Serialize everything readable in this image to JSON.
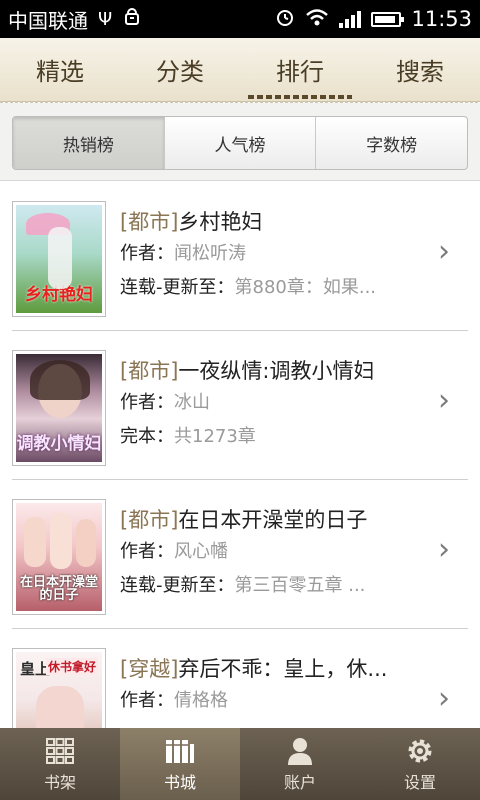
{
  "statusbar": {
    "carrier": "中国联通",
    "time": "11:53",
    "icons": [
      "usb-icon",
      "android-debug-icon",
      "alarm-icon",
      "wifi-icon",
      "signal-icon",
      "battery-icon"
    ]
  },
  "top_tabs": [
    {
      "label": "精选",
      "active": false
    },
    {
      "label": "分类",
      "active": false
    },
    {
      "label": "排行",
      "active": true
    },
    {
      "label": "搜索",
      "active": false
    }
  ],
  "ranking_tabs": [
    {
      "label": "热销榜",
      "active": true
    },
    {
      "label": "人气榜",
      "active": false
    },
    {
      "label": "字数榜",
      "active": false
    }
  ],
  "books": [
    {
      "category": "[都市]",
      "title": "乡村艳妇",
      "author_label": "作者：",
      "author": "闻松听涛",
      "status_label": "连载-更新至：",
      "status_value": "第880章：如果...",
      "cover_text": "乡村艳妇",
      "cover_color_top": "#a9d9c8",
      "cover_color_bottom": "#5e9b3d"
    },
    {
      "category": "[都市]",
      "title": "一夜纵情:调教小情妇",
      "author_label": "作者：",
      "author": "冰山",
      "status_label": "完本：",
      "status_value": "共1273章",
      "cover_text": "调教小情妇",
      "cover_color_top": "#caa7b7",
      "cover_color_bottom": "#6b4a63"
    },
    {
      "category": "[都市]",
      "title": "在日本开澡堂的日子",
      "author_label": "作者：",
      "author": "风心幡",
      "status_label": "连载-更新至：",
      "status_value": "第三百零五章 ...",
      "cover_text": "在日本开澡堂的日子",
      "cover_color_top": "#f3c7c9",
      "cover_color_bottom": "#b65f6a"
    },
    {
      "category": "[穿越]",
      "title": "弃后不乖：皇上，休...",
      "author_label": "作者：",
      "author": "倩格格",
      "status_label": "",
      "status_value": "",
      "cover_text": "休书拿好",
      "cover_sub": "皇上",
      "cover_color_top": "#f4e7e7",
      "cover_color_bottom": "#d9b2a3"
    }
  ],
  "bottom_nav": [
    {
      "label": "书架",
      "icon": "bookshelf-icon",
      "active": false
    },
    {
      "label": "书城",
      "icon": "bookstore-icon",
      "active": true
    },
    {
      "label": "账户",
      "icon": "account-icon",
      "active": false
    },
    {
      "label": "设置",
      "icon": "settings-icon",
      "active": false
    }
  ]
}
